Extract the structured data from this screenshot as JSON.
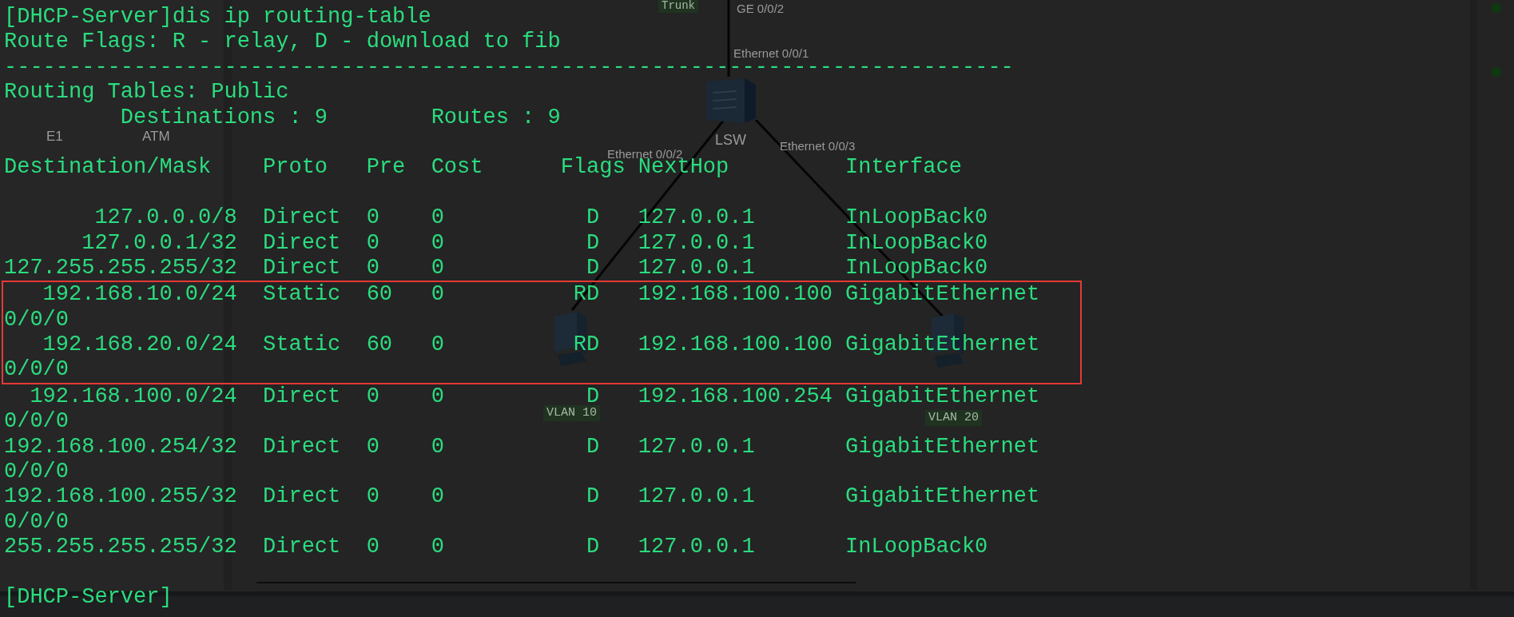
{
  "topology": {
    "trunk_tag": "Trunk",
    "port_labels": [
      "GE 0/0/2",
      "Ethernet 0/0/1",
      "Ethernet 0/0/2",
      "Ethernet 0/0/3"
    ],
    "switch_label": "LSW",
    "vlan_tags": [
      "VLAN 10",
      "VLAN 20"
    ],
    "palette_labels": [
      "E1",
      "ATM"
    ]
  },
  "terminal": {
    "command": "[DHCP-Server]dis ip routing-table",
    "legend": "Route Flags: R - relay, D - download to fib",
    "separator": "------------------------------------------------------------------------------",
    "table_title": "Routing Tables: Public",
    "destinations": "Destinations : 9",
    "routes": "Routes : 9",
    "columns": [
      "Destination/Mask",
      "Proto",
      "Pre",
      "Cost",
      "Flags",
      "NextHop",
      "Interface"
    ],
    "rows": [
      {
        "destination": "127.0.0.0/8",
        "proto": "Direct",
        "pre": "0",
        "cost": "0",
        "flags": "D",
        "nexthop": "127.0.0.1",
        "interface": "InLoopBack0",
        "highlighted": false
      },
      {
        "destination": "127.0.0.1/32",
        "proto": "Direct",
        "pre": "0",
        "cost": "0",
        "flags": "D",
        "nexthop": "127.0.0.1",
        "interface": "InLoopBack0",
        "highlighted": false
      },
      {
        "destination": "127.255.255.255/32",
        "proto": "Direct",
        "pre": "0",
        "cost": "0",
        "flags": "D",
        "nexthop": "127.0.0.1",
        "interface": "InLoopBack0",
        "highlighted": false
      },
      {
        "destination": "192.168.10.0/24",
        "proto": "Static",
        "pre": "60",
        "cost": "0",
        "flags": "RD",
        "nexthop": "192.168.100.100",
        "interface": "GigabitEthernet",
        "interface_wrap": "0/0/0",
        "highlighted": true
      },
      {
        "destination": "192.168.20.0/24",
        "proto": "Static",
        "pre": "60",
        "cost": "0",
        "flags": "RD",
        "nexthop": "192.168.100.100",
        "interface": "GigabitEthernet",
        "interface_wrap": "0/0/0",
        "highlighted": true
      },
      {
        "destination": "192.168.100.0/24",
        "proto": "Direct",
        "pre": "0",
        "cost": "0",
        "flags": "D",
        "nexthop": "192.168.100.254",
        "interface": "GigabitEthernet",
        "interface_wrap": "0/0/0",
        "highlighted": false
      },
      {
        "destination": "192.168.100.254/32",
        "proto": "Direct",
        "pre": "0",
        "cost": "0",
        "flags": "D",
        "nexthop": "127.0.0.1",
        "interface": "GigabitEthernet",
        "interface_wrap": "0/0/0",
        "highlighted": false
      },
      {
        "destination": "192.168.100.255/32",
        "proto": "Direct",
        "pre": "0",
        "cost": "0",
        "flags": "D",
        "nexthop": "127.0.0.1",
        "interface": "GigabitEthernet",
        "interface_wrap": "0/0/0",
        "highlighted": false
      },
      {
        "destination": "255.255.255.255/32",
        "proto": "Direct",
        "pre": "0",
        "cost": "0",
        "flags": "D",
        "nexthop": "127.0.0.1",
        "interface": "InLoopBack0",
        "highlighted": false
      }
    ],
    "prompt": "[DHCP-Server]"
  }
}
